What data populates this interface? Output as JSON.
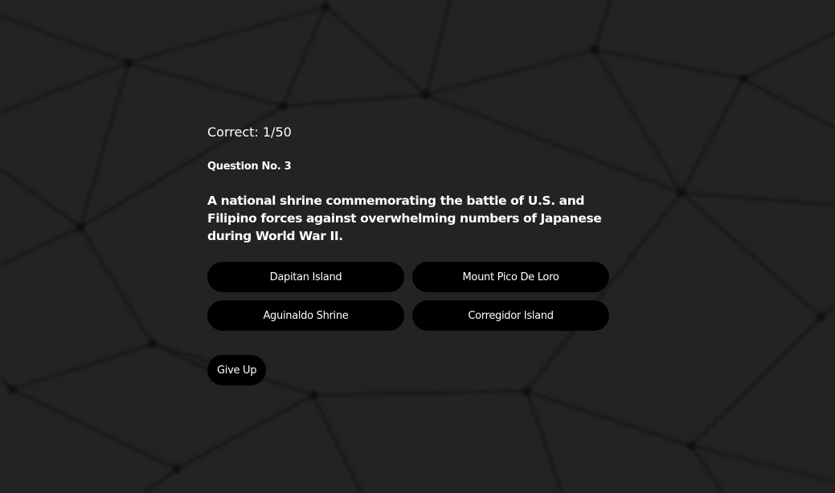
{
  "quiz": {
    "score_text": "Correct: 1/50",
    "question_number": "Question No. 3",
    "question_text": "A national shrine commemorating the battle of U.S. and Filipino forces against overwhelming numbers of Japanese during World War II.",
    "answers": [
      {
        "label": "Dapitan Island"
      },
      {
        "label": "Mount Pico De Loro"
      },
      {
        "label": "Aguinaldo Shrine"
      },
      {
        "label": "Corregidor Island"
      }
    ],
    "give_up_label": "Give Up"
  },
  "colors": {
    "background": "#232323",
    "network_lines": "#1a1a1a",
    "button_bg": "#000000",
    "text": "#ffffff"
  }
}
